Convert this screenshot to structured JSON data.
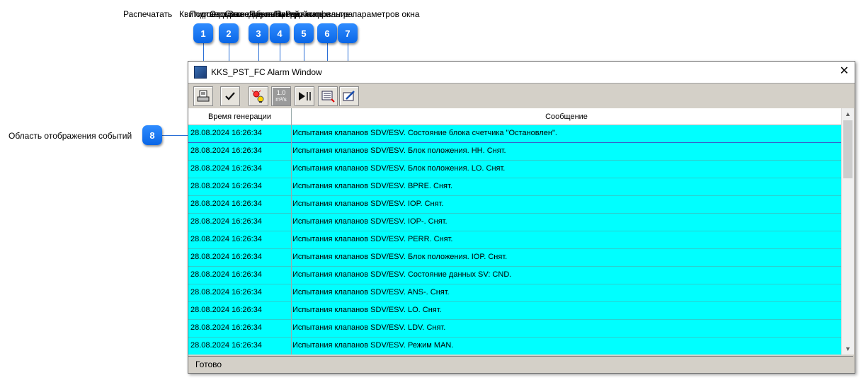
{
  "callouts": {
    "labels": [
      "Распечатать",
      "Квитировать все события",
      "Подтвердить",
      "Отображение событий",
      "Вывод данных",
      "Пауза/Продолжить",
      "Настройка фильтра",
      "Редактирование параметров окна"
    ],
    "badges": [
      "1",
      "2",
      "3",
      "4",
      "5",
      "6",
      "7",
      "8"
    ],
    "area_label": "Область отображения событий"
  },
  "window": {
    "title": "KKS_PST_FC Alarm Window",
    "close_glyph": "✕"
  },
  "toolbar": {
    "icons": [
      "printer-icon",
      "checkmark-icon",
      "alarm-lamp-icon",
      "unit-m3s-icon",
      "pause-play-icon",
      "filter-list-icon",
      "edit-window-icon"
    ],
    "unit_top": "1.0",
    "unit_bottom": "m³/s"
  },
  "table": {
    "columns": [
      "Время генерации",
      "Сообщение"
    ],
    "rows": [
      {
        "time": "28.08.2024 16:26:34",
        "message": "Испытания клапанов SDV/ESV. Состояние блока счетчика \"Остановлен\"."
      },
      {
        "time": "28.08.2024 16:26:34",
        "message": "Испытания клапанов SDV/ESV. Блок положения. HH. Снят."
      },
      {
        "time": "28.08.2024 16:26:34",
        "message": "Испытания клапанов SDV/ESV. Блок положения. LO. Снят."
      },
      {
        "time": "28.08.2024 16:26:34",
        "message": "Испытания клапанов SDV/ESV. BPRE. Снят."
      },
      {
        "time": "28.08.2024 16:26:34",
        "message": "Испытания клапанов SDV/ESV. IOP. Снят."
      },
      {
        "time": "28.08.2024 16:26:34",
        "message": "Испытания клапанов SDV/ESV. IOP-. Снят."
      },
      {
        "time": "28.08.2024 16:26:34",
        "message": "Испытания клапанов SDV/ESV. PERR. Снят."
      },
      {
        "time": "28.08.2024 16:26:34",
        "message": "Испытания клапанов SDV/ESV. Блок положения. IOP. Снят."
      },
      {
        "time": "28.08.2024 16:26:34",
        "message": "Испытания клапанов SDV/ESV. Состояние данных SV: CND."
      },
      {
        "time": "28.08.2024 16:26:34",
        "message": "Испытания клапанов SDV/ESV. ANS-. Снят."
      },
      {
        "time": "28.08.2024 16:26:34",
        "message": "Испытания клапанов SDV/ESV. LO. Снят."
      },
      {
        "time": "28.08.2024 16:26:34",
        "message": "Испытания клапанов SDV/ESV. LDV. Снят."
      },
      {
        "time": "28.08.2024 16:26:34",
        "message": "Испытания клапанов SDV/ESV. Режим MAN."
      }
    ]
  },
  "status": {
    "text": "Готово"
  },
  "colors": {
    "row_bg": "#00ffff",
    "badge": "#1a7cf5",
    "window_bg": "#d4d0c8"
  }
}
